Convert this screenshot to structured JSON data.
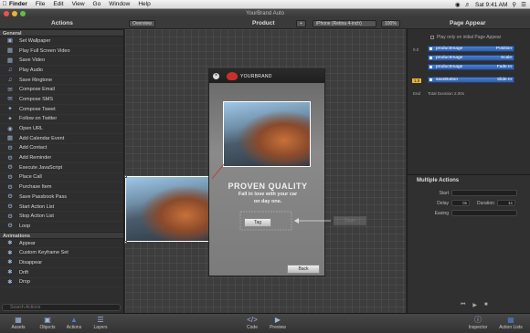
{
  "menubar": {
    "app": "Finder",
    "items": [
      "File",
      "Edit",
      "View",
      "Go",
      "Window",
      "Help"
    ],
    "clock": "Sat 9:41 AM"
  },
  "window": {
    "title": "YourBrand Auto"
  },
  "toolbar": {
    "left_title": "Actions",
    "overview": "Overview",
    "product": "Product",
    "plus": "+",
    "device": "iPhone (Retina 4-inch)",
    "zoom": "100%",
    "right_title": "Page Appear"
  },
  "actions": {
    "general_label": "General",
    "general": [
      {
        "label": "Set Wallpaper",
        "icon": "wallpaper-icon"
      },
      {
        "label": "Play Full Screen Video",
        "icon": "video-icon"
      },
      {
        "label": "Save Video",
        "icon": "video-save-icon"
      },
      {
        "label": "Play Audio",
        "icon": "audio-icon"
      },
      {
        "label": "Save Ringtone",
        "icon": "ringtone-icon"
      },
      {
        "label": "Compose Email",
        "icon": "email-icon"
      },
      {
        "label": "Compose SMS",
        "icon": "sms-icon"
      },
      {
        "label": "Compose Tweet",
        "icon": "tweet-icon"
      },
      {
        "label": "Follow on Twitter",
        "icon": "twitter-icon"
      },
      {
        "label": "Open URL",
        "icon": "globe-icon"
      },
      {
        "label": "Add Calendar Event",
        "icon": "calendar-icon"
      },
      {
        "label": "Add Contact",
        "icon": "gear-icon"
      },
      {
        "label": "Add Reminder",
        "icon": "gear-icon"
      },
      {
        "label": "Execute JavaScript",
        "icon": "gear-icon"
      },
      {
        "label": "Place Call",
        "icon": "gear-icon"
      },
      {
        "label": "Purchase Item",
        "icon": "gear-icon"
      },
      {
        "label": "Save Passbook Pass",
        "icon": "gear-icon"
      },
      {
        "label": "Start Action List",
        "icon": "gear-icon"
      },
      {
        "label": "Stop Action List",
        "icon": "gear-icon"
      },
      {
        "label": "Loop",
        "icon": "gear-icon"
      }
    ],
    "animations_label": "Animations",
    "animations": [
      {
        "label": "Appear",
        "icon": "appear-icon"
      },
      {
        "label": "Custom Keyframe Set",
        "icon": "keyframe-icon"
      },
      {
        "label": "Disappear",
        "icon": "disappear-icon"
      },
      {
        "label": "Drift",
        "icon": "drift-icon"
      },
      {
        "label": "Drop",
        "icon": "drop-icon"
      }
    ],
    "search_placeholder": "Search Actions"
  },
  "phone": {
    "brand": "YOURBRAND",
    "headline": "PROVEN QUALITY",
    "sub1": "Fall in love with your car",
    "sub2": "on day one.",
    "tag_button": "Tag",
    "back_button": "Back"
  },
  "canvas": {
    "ghost_button": "Save"
  },
  "page_appear": {
    "checkbox_label": "Play only on initial Page Appear",
    "tracks": [
      {
        "name": "productImage",
        "property": "Position"
      },
      {
        "name": "productImage",
        "property": "Scale"
      },
      {
        "name": "productImage",
        "property": "Fade In"
      },
      {
        "name": "saveButton",
        "property": "Slide In"
      }
    ],
    "time_start": "0.0",
    "time_mid": "1.0",
    "time_end": "End",
    "total_duration": "Total Duration 2.00s"
  },
  "multiple_actions": {
    "title": "Multiple Actions",
    "start_label": "Start",
    "delay_label": "Delay",
    "delay_value": "0s",
    "duration_label": "Duration",
    "duration_value": "1s",
    "easing_label": "Easing"
  },
  "bottombar": {
    "left": [
      "Assets",
      "Objects",
      "Actions",
      "Layers"
    ],
    "center": [
      "Code",
      "Preview"
    ],
    "right": [
      "Inspector",
      "Action Lists"
    ]
  },
  "colors": {
    "accent": "#4a7fd1",
    "brand_red": "#c8302c"
  }
}
